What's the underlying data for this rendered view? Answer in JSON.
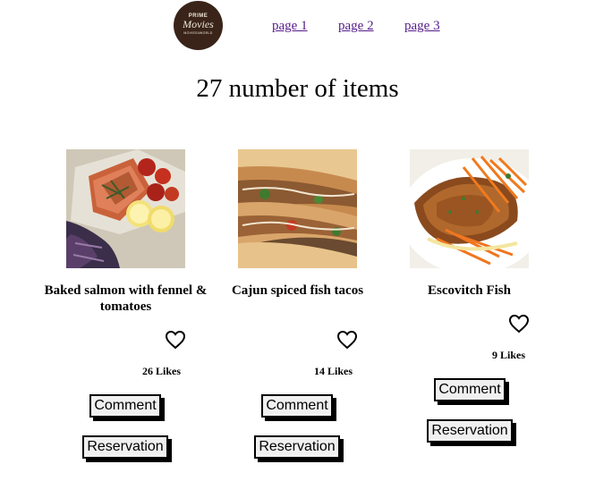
{
  "header": {
    "logo": {
      "line1": "PRIME",
      "line2": "Movies",
      "line3": "MOVIES4WORLD"
    },
    "nav": [
      "page 1",
      "page 2",
      "page 3"
    ]
  },
  "main": {
    "count_title": "27 number of items"
  },
  "items": [
    {
      "title": "Baked salmon with fennel & tomatoes",
      "likes": "26 Likes",
      "comment_label": "Comment",
      "reservation_label": "Reservation"
    },
    {
      "title": "Cajun spiced fish tacos",
      "likes": "14 Likes",
      "comment_label": "Comment",
      "reservation_label": "Reservation"
    },
    {
      "title": "Escovitch Fish",
      "likes": "9 Likes",
      "comment_label": "Comment",
      "reservation_label": "Reservation"
    }
  ],
  "colors": {
    "logo_bg": "#3a2419",
    "link": "#551a8b",
    "button_bg": "#f0f0f0"
  },
  "icons": {
    "like": "heart-outline-icon"
  }
}
